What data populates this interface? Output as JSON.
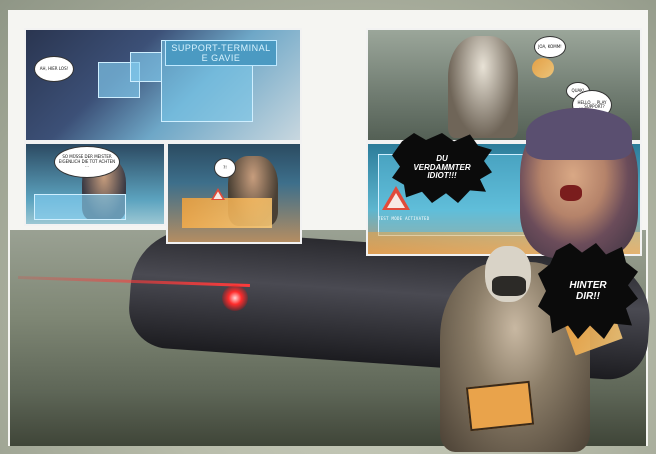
{
  "panels": {
    "p1": {
      "terminal_title_line1": "SUPPORT-TERMINAL",
      "terminal_title_line2": "E GAVIE",
      "bubble": "AH, HIER LOS!"
    },
    "p2": {
      "bubble": "SO MÜSSE DER MEISTER EIGENLICH DIE TÜT ACHTEN ..."
    },
    "p3": {
      "bubble": "?!"
    },
    "p4": {
      "bubble_1": "JOA, KOMM!",
      "bubble_2": "QUAK!",
      "bubble_3": "HELLO ... PLAY ... SUPPORT?"
    },
    "p5": {
      "hud_text": "TEST MODE ACTIVATED"
    }
  },
  "shouts": {
    "du": "DU VERDAMMTER IDIOT!!!",
    "hinter": "HINTER DIR!!"
  },
  "colors": {
    "laser": "#ff2b2b",
    "hud_blue": "#5db6cf",
    "warning_red": "#e14a3a",
    "orange": "#f4a23a"
  }
}
